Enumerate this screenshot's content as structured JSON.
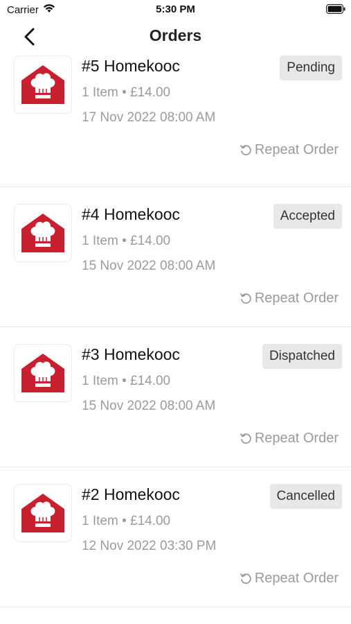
{
  "status_bar": {
    "carrier": "Carrier",
    "time": "5:30 PM"
  },
  "header": {
    "title": "Orders"
  },
  "orders": [
    {
      "title": "#5 Homekooc",
      "meta": "1  Item • £14.00",
      "date": "17 Nov 2022 08:00 AM",
      "status": "Pending",
      "repeat_label": "Repeat Order"
    },
    {
      "title": "#4 Homekooc",
      "meta": "1  Item • £14.00",
      "date": "15 Nov 2022 08:00 AM",
      "status": "Accepted",
      "repeat_label": "Repeat Order"
    },
    {
      "title": "#3 Homekooc",
      "meta": "1  Item • £14.00",
      "date": "15 Nov 2022 08:00 AM",
      "status": "Dispatched",
      "repeat_label": "Repeat Order"
    },
    {
      "title": "#2 Homekooc",
      "meta": "1  Item • £14.00",
      "date": "12 Nov 2022 03:30 PM",
      "status": "Cancelled",
      "repeat_label": "Repeat Order"
    }
  ],
  "colors": {
    "brand_red": "#c8202f",
    "muted_text": "#9b9b9b",
    "badge_bg": "#e8e8e8"
  }
}
